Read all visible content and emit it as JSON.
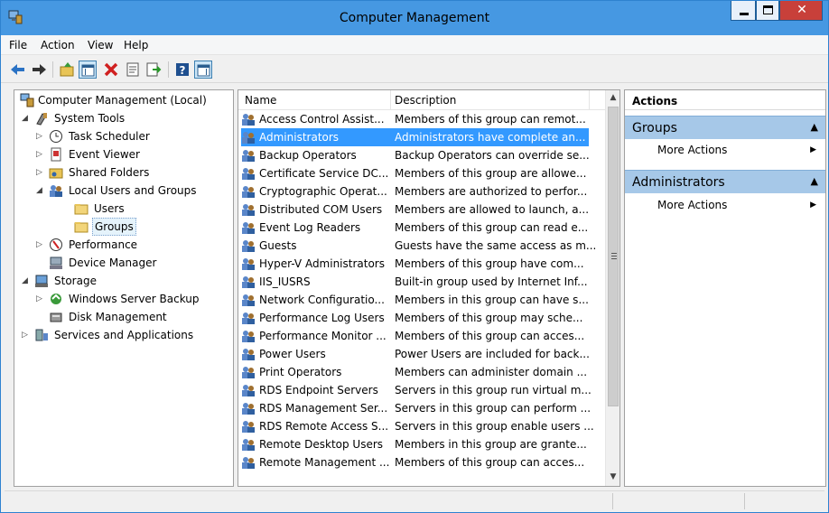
{
  "window": {
    "title": "Computer Management"
  },
  "menu": [
    "File",
    "Action",
    "View",
    "Help"
  ],
  "tree": {
    "root": "Computer Management (Local)",
    "system_tools": "System Tools",
    "task_scheduler": "Task Scheduler",
    "event_viewer": "Event Viewer",
    "shared_folders": "Shared Folders",
    "local_users_groups": "Local Users and Groups",
    "users": "Users",
    "groups": "Groups",
    "performance": "Performance",
    "device_manager": "Device Manager",
    "storage": "Storage",
    "windows_server_backup": "Windows Server Backup",
    "disk_management": "Disk Management",
    "services_apps": "Services and Applications"
  },
  "list": {
    "columns": {
      "name": "Name",
      "description": "Description"
    },
    "rows": [
      {
        "name": "Access Control Assist...",
        "description": "Members of this group can remot..."
      },
      {
        "name": "Administrators",
        "description": "Administrators have complete an..."
      },
      {
        "name": "Backup Operators",
        "description": "Backup Operators can override se..."
      },
      {
        "name": "Certificate Service DC...",
        "description": "Members of this group are allowe..."
      },
      {
        "name": "Cryptographic Operat...",
        "description": "Members are authorized to perfor..."
      },
      {
        "name": "Distributed COM Users",
        "description": "Members are allowed to launch, a..."
      },
      {
        "name": "Event Log Readers",
        "description": "Members of this group can read e..."
      },
      {
        "name": "Guests",
        "description": "Guests have the same access as m..."
      },
      {
        "name": "Hyper-V Administrators",
        "description": "Members of this group have com..."
      },
      {
        "name": "IIS_IUSRS",
        "description": "Built-in group used by Internet Inf..."
      },
      {
        "name": "Network Configuratio...",
        "description": "Members in this group can have s..."
      },
      {
        "name": "Performance Log Users",
        "description": "Members of this group may sche..."
      },
      {
        "name": "Performance Monitor ...",
        "description": "Members of this group can acces..."
      },
      {
        "name": "Power Users",
        "description": "Power Users are included for back..."
      },
      {
        "name": "Print Operators",
        "description": "Members can administer domain ..."
      },
      {
        "name": "RDS Endpoint Servers",
        "description": "Servers in this group run virtual m..."
      },
      {
        "name": "RDS Management Ser...",
        "description": "Servers in this group can perform ..."
      },
      {
        "name": "RDS Remote Access S...",
        "description": "Servers in this group enable users ..."
      },
      {
        "name": "Remote Desktop Users",
        "description": "Members in this group are grante..."
      },
      {
        "name": "Remote Management ...",
        "description": "Members of this group can acces..."
      }
    ],
    "selected_index": 1
  },
  "actions": {
    "title": "Actions",
    "sections": [
      {
        "header": "Groups",
        "item": "More Actions"
      },
      {
        "header": "Administrators",
        "item": "More Actions"
      }
    ]
  },
  "colors": {
    "titlebar": "#4698e2",
    "selection": "#3399ff",
    "actions_header": "#a6c8e8"
  }
}
